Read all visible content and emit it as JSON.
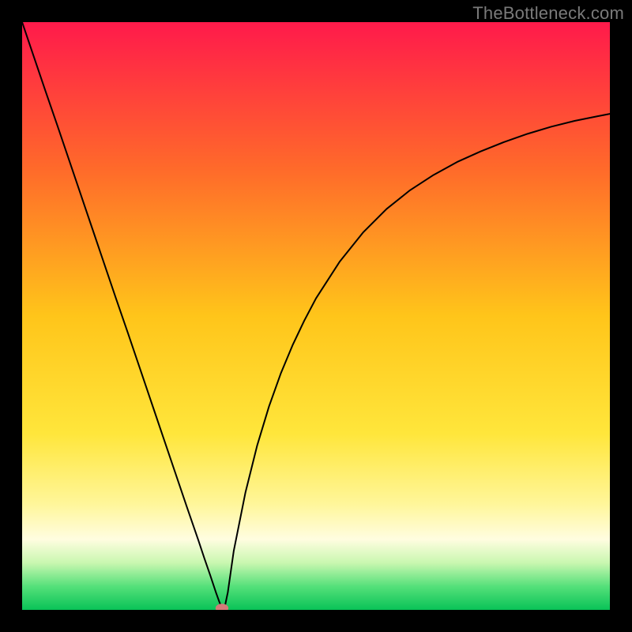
{
  "watermark": "TheBottleneck.com",
  "branding_color": "#7a7a7a",
  "chart_data": {
    "type": "line",
    "title": "",
    "xlabel": "",
    "ylabel": "",
    "xlim": [
      0,
      100
    ],
    "ylim": [
      0,
      100
    ],
    "grid": false,
    "background_gradient_stops": [
      {
        "offset": 0,
        "color": "#ff1a4b"
      },
      {
        "offset": 25,
        "color": "#ff6a2a"
      },
      {
        "offset": 50,
        "color": "#ffc51a"
      },
      {
        "offset": 70,
        "color": "#ffe63b"
      },
      {
        "offset": 82,
        "color": "#fff69a"
      },
      {
        "offset": 88,
        "color": "#fffde0"
      },
      {
        "offset": 92,
        "color": "#c9f7b0"
      },
      {
        "offset": 96,
        "color": "#55e07a"
      },
      {
        "offset": 100,
        "color": "#09c357"
      }
    ],
    "series": [
      {
        "name": "bottleneck-curve",
        "stroke": "#000000",
        "stroke_width": 2,
        "x": [
          0,
          2,
          4,
          6,
          8,
          10,
          12,
          14,
          16,
          18,
          20,
          22,
          24,
          26,
          28,
          30,
          31,
          32,
          33,
          33.5,
          34,
          34.5,
          35,
          36,
          38,
          40,
          42,
          44,
          46,
          48,
          50,
          54,
          58,
          62,
          66,
          70,
          74,
          78,
          82,
          86,
          90,
          94,
          98,
          100
        ],
        "y": [
          100,
          94.1,
          88.2,
          82.4,
          76.5,
          70.6,
          64.7,
          58.8,
          52.9,
          47.1,
          41.2,
          35.3,
          29.4,
          23.5,
          17.6,
          11.8,
          8.8,
          5.9,
          2.9,
          1.5,
          0.3,
          0.6,
          3.0,
          10.0,
          20.0,
          28.0,
          34.6,
          40.2,
          45.0,
          49.2,
          53.0,
          59.2,
          64.2,
          68.2,
          71.4,
          74.0,
          76.2,
          78.0,
          79.6,
          81.0,
          82.2,
          83.2,
          84.0,
          84.4
        ]
      }
    ],
    "marker": {
      "name": "optimal-point",
      "x": 34,
      "y": 0.3,
      "rx": 1.1,
      "ry": 0.75,
      "fill": "#d47a78"
    }
  }
}
